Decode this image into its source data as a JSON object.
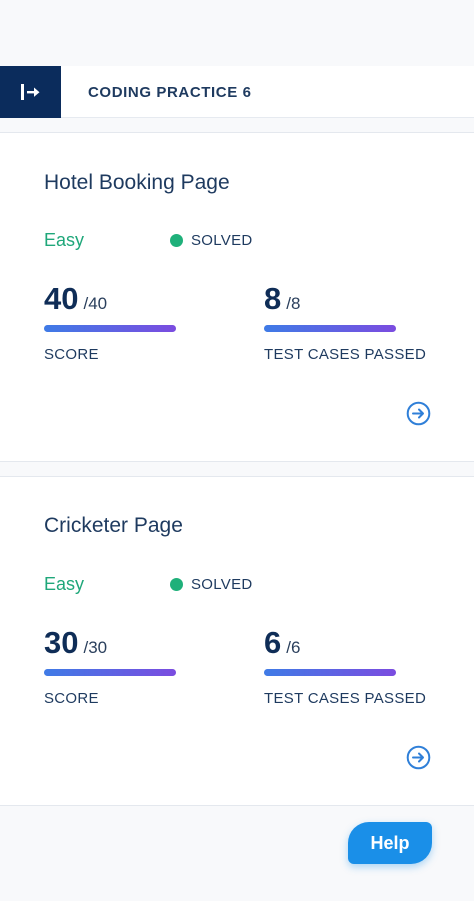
{
  "header": {
    "title": "CODING PRACTICE 6",
    "toggle_icon": "sidebar-expand-icon"
  },
  "problems": [
    {
      "title": "Hotel Booking Page",
      "difficulty": "Easy",
      "status": "SOLVED",
      "score": {
        "value": "40",
        "total": "/40",
        "label": "SCORE",
        "fraction": 1.0
      },
      "tests": {
        "value": "8",
        "total": "/8",
        "label": "TEST CASES PASSED",
        "fraction": 1.0
      },
      "action_icon": "arrow-right-circle-icon"
    },
    {
      "title": "Cricketer Page",
      "difficulty": "Easy",
      "status": "SOLVED",
      "score": {
        "value": "30",
        "total": "/30",
        "label": "SCORE",
        "fraction": 1.0
      },
      "tests": {
        "value": "6",
        "total": "/6",
        "label": "TEST CASES PASSED",
        "fraction": 1.0
      },
      "action_icon": "arrow-right-circle-icon"
    }
  ],
  "help": {
    "label": "Help"
  },
  "colors": {
    "brand_navy": "#0b2c5c",
    "easy_green": "#1fa77a",
    "solved_dot": "#1fb07a",
    "help_blue": "#1a8fe8",
    "bar_start": "#3f7be6",
    "bar_end": "#7b4ce0"
  }
}
